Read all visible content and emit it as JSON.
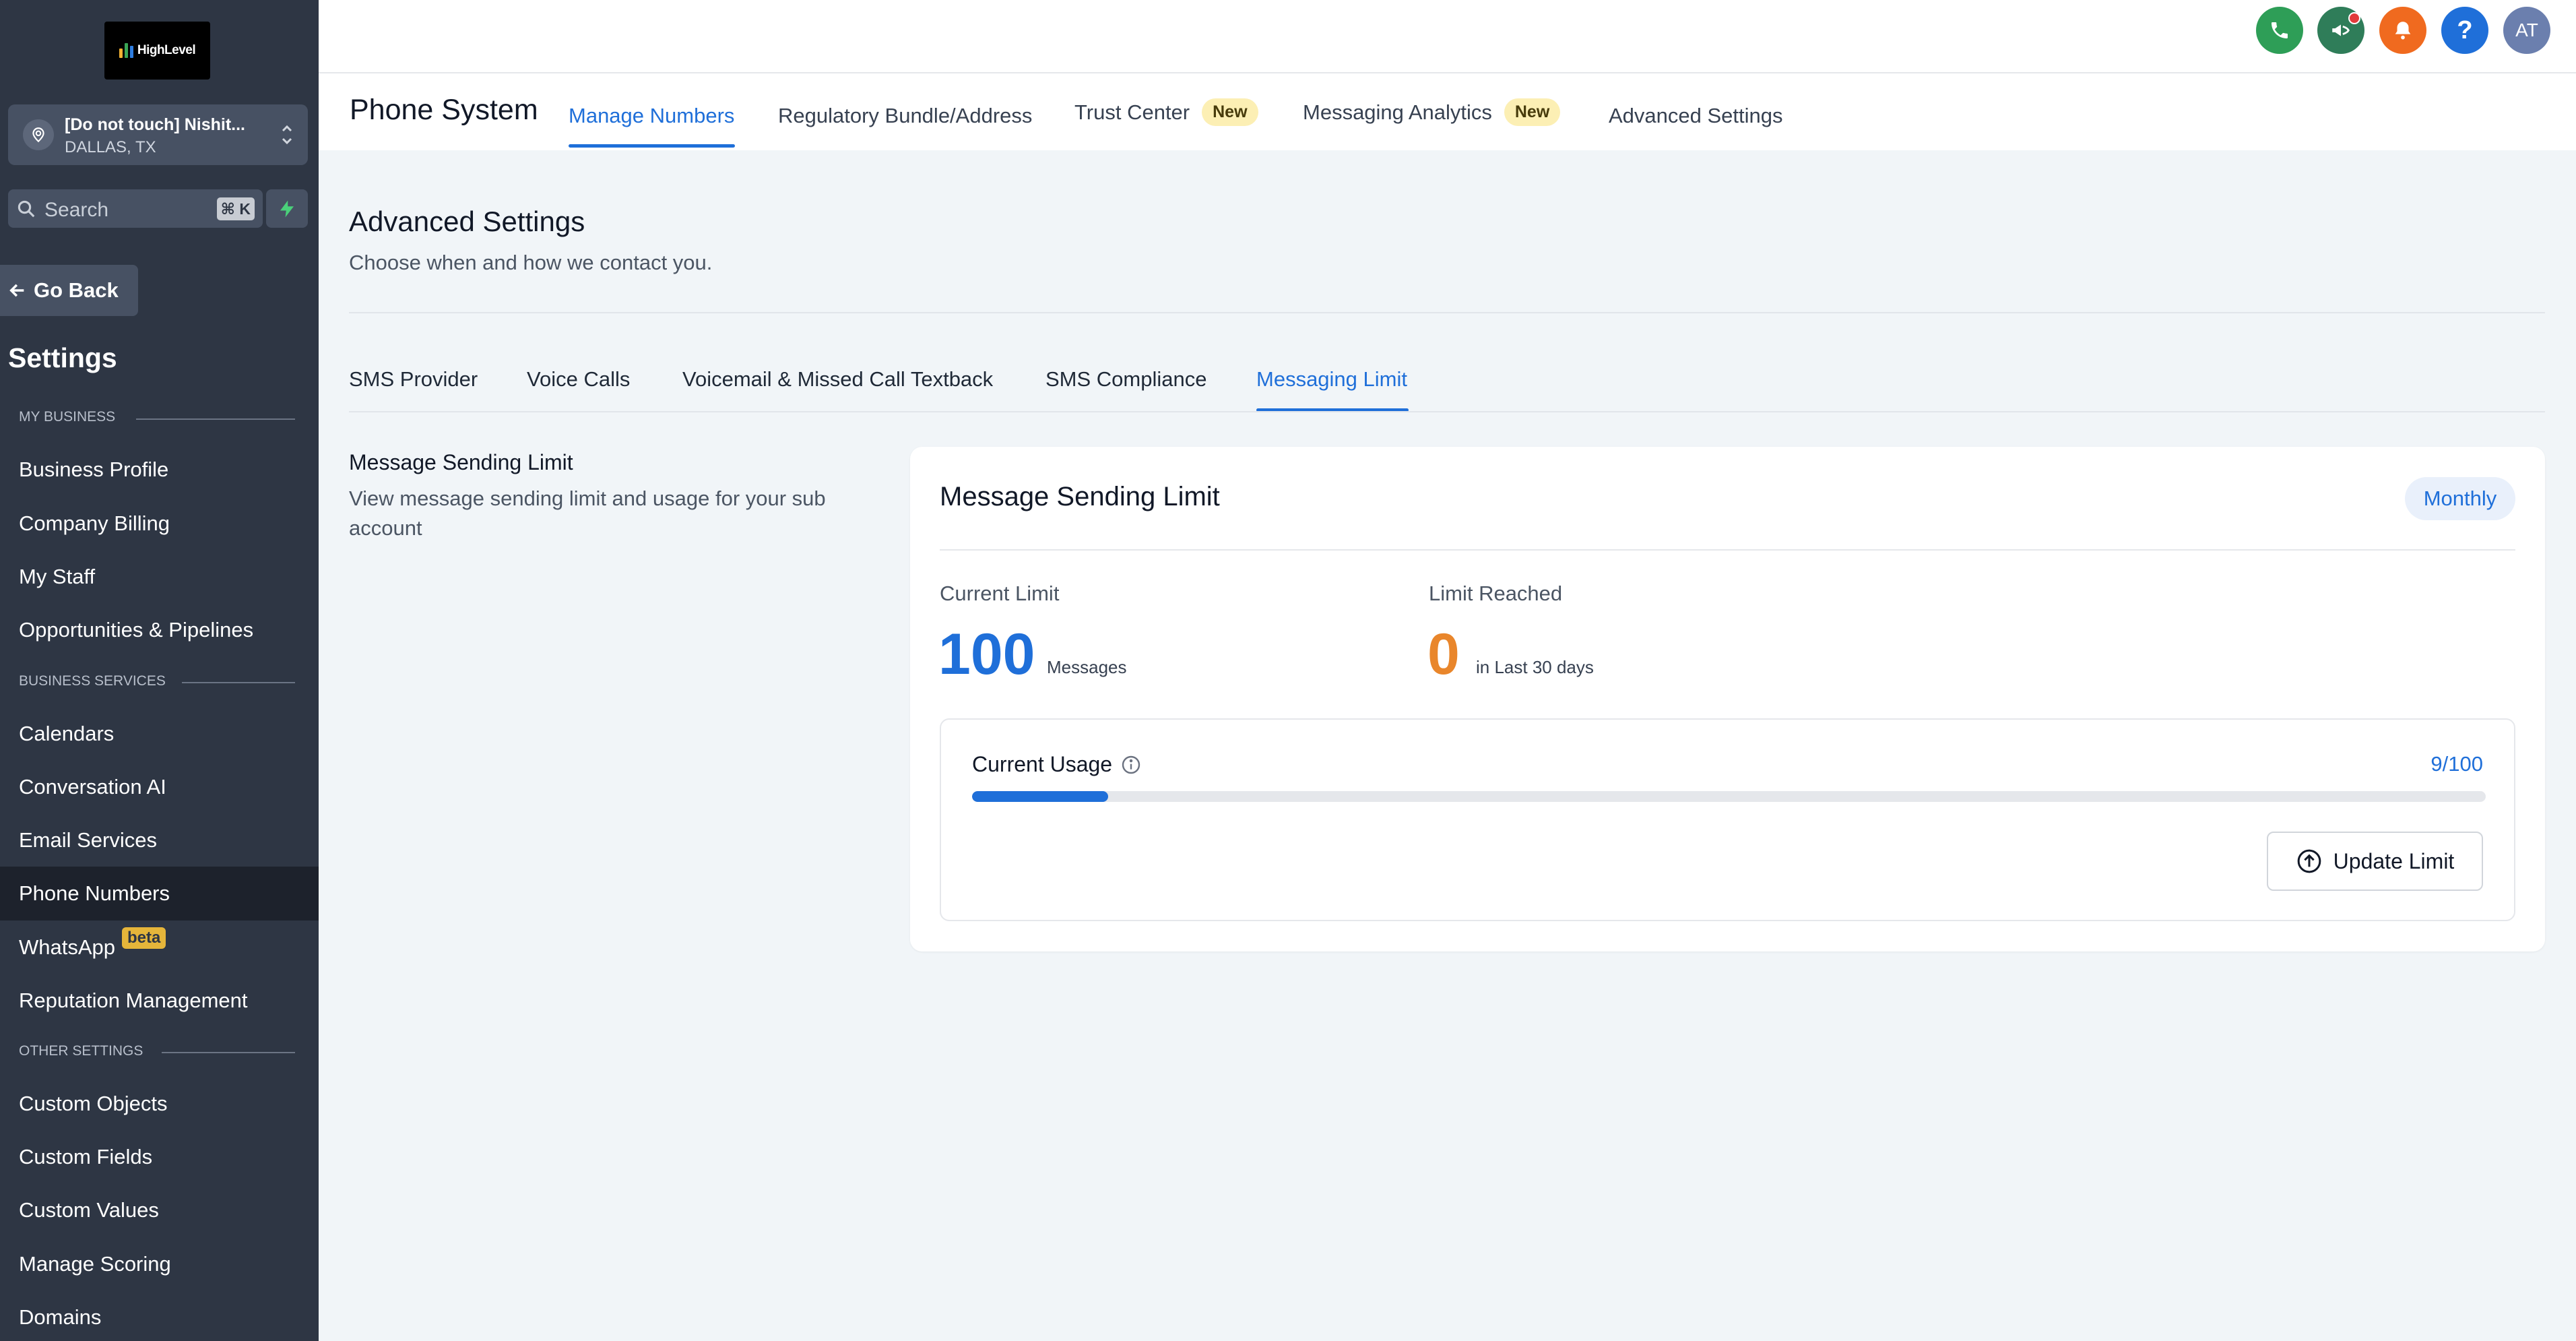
{
  "brand": {
    "logo_text": "HighLevel",
    "bar_colors": [
      "#f2b233",
      "#3aa655",
      "#2e7de0"
    ]
  },
  "account": {
    "name": "[Do not touch] Nishit...",
    "location": "DALLAS, TX"
  },
  "search": {
    "label": "Search",
    "shortcut": "⌘ K"
  },
  "sidebar": {
    "go_back": "Go Back",
    "title": "Settings",
    "sections": {
      "my_business": "MY BUSINESS",
      "business_services": "BUSINESS SERVICES",
      "other_settings": "OTHER SETTINGS"
    },
    "items": [
      "Business Profile",
      "Company Billing",
      "My Staff",
      "Opportunities & Pipelines",
      "Calendars",
      "Conversation AI",
      "Email Services",
      "Phone Numbers",
      "WhatsApp",
      "Reputation Management",
      "Custom Objects",
      "Custom Fields",
      "Custom Values",
      "Manage Scoring",
      "Domains"
    ],
    "whatsapp_badge": "beta"
  },
  "header": {
    "avatar_initials": "AT",
    "help_glyph": "?",
    "icon_colors": {
      "phone": "#2e9e57",
      "megaphone": "#2f7d59",
      "bell": "#f06a1f",
      "help": "#1f6fd9",
      "avatar": "#6b7fae"
    }
  },
  "app": {
    "title": "Phone System",
    "tabs": [
      {
        "label": "Manage Numbers",
        "active": true
      },
      {
        "label": "Regulatory Bundle/Address"
      },
      {
        "label": "Trust Center",
        "badge": "New"
      },
      {
        "label": "Messaging Analytics",
        "badge": "New"
      },
      {
        "label": "Advanced Settings"
      }
    ]
  },
  "page": {
    "title": "Advanced Settings",
    "subtitle": "Choose when and how we contact you.",
    "tabs": [
      "SMS Provider",
      "Voice Calls",
      "Voicemail & Missed Call Textback",
      "SMS Compliance",
      "Messaging Limit"
    ],
    "active_tab": "Messaging Limit"
  },
  "section": {
    "heading": "Message Sending Limit",
    "description": "View message sending limit and usage for your sub account"
  },
  "card": {
    "title": "Message Sending Limit",
    "period": "Monthly",
    "current_limit": {
      "label": "Current Limit",
      "value": "100",
      "unit": "Messages"
    },
    "limit_reached": {
      "label": "Limit Reached",
      "value": "0",
      "unit": "in Last 30 days"
    },
    "usage": {
      "label": "Current Usage",
      "count": "9/100",
      "used": 9,
      "total": 100
    },
    "update_button": "Update Limit",
    "accent_blue": "#1f6fd9",
    "accent_orange": "#e9862b"
  }
}
